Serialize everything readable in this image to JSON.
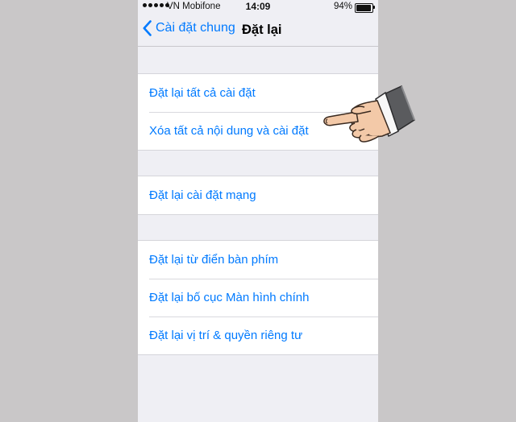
{
  "status_bar": {
    "carrier": "VN Mobifone",
    "time": "14:09",
    "battery": "94%",
    "battery_level": 0.94
  },
  "nav": {
    "back_label": "Cài đặt chung",
    "title": "Đặt lại"
  },
  "groups": [
    {
      "items": [
        {
          "label": "Đặt lại tất cả cài đặt"
        },
        {
          "label": "Xóa tất cả nội dung và cài đặt"
        }
      ]
    },
    {
      "items": [
        {
          "label": "Đặt lại cài đặt mạng"
        }
      ]
    },
    {
      "items": [
        {
          "label": "Đặt lại từ điển bàn phím"
        },
        {
          "label": "Đặt lại bố cục Màn hình chính"
        },
        {
          "label": "Đặt lại vị trí & quyền riêng tư"
        }
      ]
    }
  ],
  "colors": {
    "accent": "#007aff",
    "background": "#efeff4",
    "page_background": "#c9c7c8"
  },
  "icons": {
    "back": "chevron-left-icon",
    "pointer": "pointing-hand-icon"
  }
}
